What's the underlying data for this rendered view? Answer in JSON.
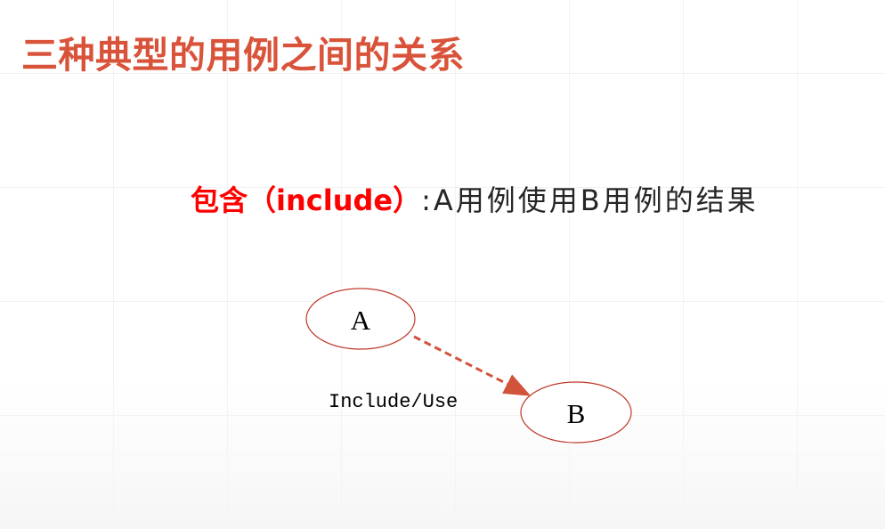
{
  "slide": {
    "title": "三种典型的用例之间的关系",
    "subtitle": {
      "term": "包含（include）",
      "description": ":A用例使用B用例的结果"
    }
  },
  "diagram": {
    "nodes": [
      {
        "id": "A",
        "label": "A"
      },
      {
        "id": "B",
        "label": "B"
      }
    ],
    "edges": [
      {
        "from": "A",
        "to": "B",
        "label": "Include/Use",
        "style": "dashed",
        "arrow": "to"
      }
    ]
  },
  "colors": {
    "title": "#d9533a",
    "term": "#ff0000",
    "description": "#262626",
    "ellipse_stroke": "#c0392b",
    "edge": "#d1543a",
    "node_text": "#000000"
  }
}
